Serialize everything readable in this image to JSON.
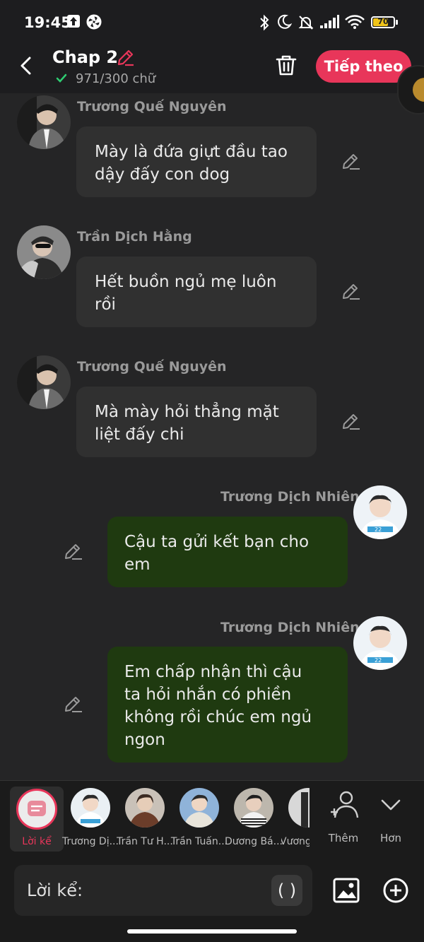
{
  "status_bar": {
    "time": "19:45",
    "battery": "70",
    "battery_level_percent": 70,
    "icons": [
      "upload-icon",
      "aperture-icon",
      "bluetooth-icon",
      "moon-icon",
      "bell-off-icon",
      "signal-icon",
      "wifi-icon",
      "battery-icon"
    ]
  },
  "header": {
    "title": "Chap 2",
    "word_count": "971/300 chữ",
    "next_label": "Tiếp theo",
    "accent": "#e8365a"
  },
  "messages": [
    {
      "side": "left",
      "sender": "Trương Quế Nguyên",
      "lines": [
        "Mày là đứa giựt đầu tao",
        "dậy đấy con dog"
      ]
    },
    {
      "side": "left",
      "sender": "Trần Dịch Hằng",
      "lines": [
        "Hết buồn ngủ mẹ luôn",
        "rồi"
      ]
    },
    {
      "side": "left",
      "sender": "Trương Quế Nguyên",
      "lines": [
        "Mà mày hỏi thẳng mặt",
        "liệt đấy chi"
      ]
    },
    {
      "side": "right",
      "sender": "Trương Dịch Nhiên",
      "lines": [
        "Cậu ta gửi kết bạn cho",
        "em"
      ]
    },
    {
      "side": "right",
      "sender": "Trương Dịch Nhiên",
      "lines": [
        "Em chấp nhận thì cậu",
        "ta hỏi nhắn có phiền",
        "không rồi chúc em ngủ",
        "ngon"
      ]
    }
  ],
  "characters": {
    "narration_label": "Lời kể",
    "items": [
      "Trương Dị...",
      "Trần Tư H...",
      "Trần Tuấn...",
      "Dương Bá...",
      "Vương"
    ],
    "add_label": "Thêm",
    "more_label": "Hơn"
  },
  "input": {
    "label": "Lời kể:",
    "paren": "( )"
  }
}
